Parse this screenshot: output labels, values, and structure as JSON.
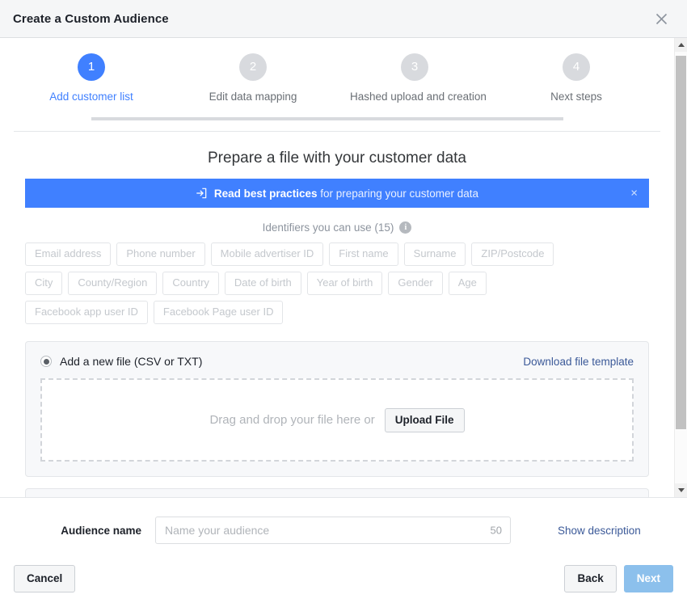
{
  "window": {
    "title": "Create a Custom Audience",
    "close_icon": "close-icon"
  },
  "stepper": {
    "steps": [
      {
        "number": "1",
        "label": "Add customer list",
        "active": true
      },
      {
        "number": "2",
        "label": "Edit data mapping",
        "active": false
      },
      {
        "number": "3",
        "label": "Hashed upload and creation",
        "active": false
      },
      {
        "number": "4",
        "label": "Next steps",
        "active": false
      }
    ],
    "active_color": "#4080ff",
    "inactive_color": "#d8dade"
  },
  "main": {
    "heading": "Prepare a file with your customer data",
    "banner": {
      "icon": "open-in-new-icon",
      "strong_text": "Read best practices",
      "rest_text": " for preparing your customer data",
      "close_label": "×",
      "background": "#4080ff"
    },
    "identifiers": {
      "heading": "Identifiers you can use (15)",
      "info_icon_label": "i",
      "chips": [
        "Email address",
        "Phone number",
        "Mobile advertiser ID",
        "First name",
        "Surname",
        "ZIP/Postcode",
        "City",
        "County/Region",
        "Country",
        "Date of birth",
        "Year of birth",
        "Gender",
        "Age",
        "Facebook app user ID",
        "Facebook Page user ID"
      ]
    },
    "upload_card": {
      "radio_label": "Add a new file (CSV or TXT)",
      "radio_selected": true,
      "download_template_link": "Download file template",
      "dropzone_text": "Drag and drop your file here or",
      "upload_button": "Upload File"
    }
  },
  "scrollbar": {
    "up_arrow": "scroll-up-icon",
    "down_arrow": "scroll-down-icon"
  },
  "footer": {
    "audience_name_label": "Audience name",
    "audience_name_value": "",
    "audience_name_placeholder": "Name your audience",
    "char_count": "50",
    "show_description_link": "Show description",
    "cancel_button": "Cancel",
    "back_button": "Back",
    "next_button": "Next",
    "next_button_color": "#8cc0ec"
  }
}
